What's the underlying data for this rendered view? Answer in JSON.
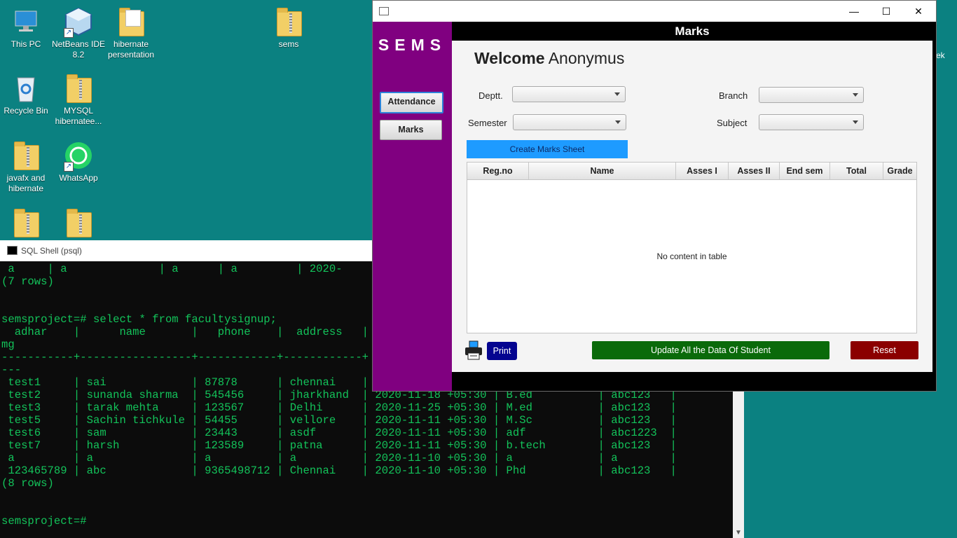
{
  "desktop": {
    "icons": [
      {
        "label": "This PC"
      },
      {
        "label": "NetBeans IDE 8.2"
      },
      {
        "label": "hibernate persentation"
      },
      {
        "label": "sems"
      },
      {
        "label": "Recycle Bin"
      },
      {
        "label": "MYSQL hibernatee..."
      },
      {
        "label": "javafx and hibernate"
      },
      {
        "label": "WhatsApp"
      }
    ],
    "edge_text": "ek"
  },
  "sql_shell": {
    "title": "SQL Shell (psql)",
    "text": " a     | a              | a      | a         | 2020-\n(7 rows)\n\n\nsemsproject=# select * from facultysignup;\n  adhar    |      name       |   phone    |  address   |\nmg\n-----------+-----------------+------------+------------+\n---\n test1     | sai             | 87878      | chennai    |\n test2     | sunanda sharma  | 545456     | jharkhand  | 2020-11-18 +05:30 | B.ed          | abc123   |\n test3     | tarak mehta     | 123567     | Delhi      | 2020-11-25 +05:30 | M.ed          | abc123   |\n test5     | Sachin tichkule | 54455      | vellore    | 2020-11-11 +05:30 | M.Sc          | abc123   |\n test6     | sam             | 23443      | asdf       | 2020-11-11 +05:30 | adf           | abc1223  |\n test7     | harsh           | 123589     | patna      | 2020-11-11 +05:30 | b.tech        | abc123   |\n a         | a               | a          | a          | 2020-11-10 +05:30 | a             | a        |\n 123465789 | abc             | 9365498712 | Chennai    | 2020-11-10 +05:30 | Phd           | abc123   |\n(8 rows)\n\n\nsemsproject=#"
  },
  "app": {
    "logo": "SEMS",
    "nav": {
      "attendance": "Attendance",
      "marks": "Marks"
    },
    "header": "Marks",
    "welcome": {
      "prefix": "Welcome",
      "user": "Anonymus"
    },
    "filters": {
      "deptt": "Deptt.",
      "branch": "Branch",
      "semester": "Semester",
      "subject": "Subject"
    },
    "create_button": "Create Marks Sheet",
    "table": {
      "columns": [
        "Reg.no",
        "Name",
        "Asses I",
        "Asses II",
        "End sem",
        "Total",
        "Grade"
      ],
      "empty": "No content in table"
    },
    "print_button": "Print",
    "update_button": "Update All the Data Of Student",
    "reset_button": "Reset"
  }
}
